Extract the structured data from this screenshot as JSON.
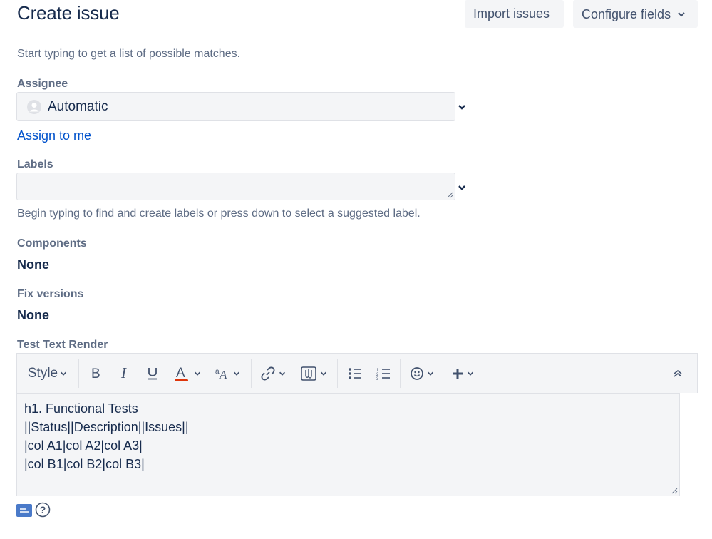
{
  "header": {
    "title": "Create issue",
    "import_label": "Import issues",
    "configure_label": "Configure fields"
  },
  "assignee": {
    "help_text": "Start typing to get a list of possible matches.",
    "label": "Assignee",
    "value": "Automatic",
    "assign_to_me": "Assign to me"
  },
  "labels": {
    "label": "Labels",
    "value": "",
    "help_text": "Begin typing to find and create labels or press down to select a suggested label."
  },
  "components": {
    "label": "Components",
    "value": "None"
  },
  "fix_versions": {
    "label": "Fix versions",
    "value": "None"
  },
  "test_text_render": {
    "label": "Test Text Render",
    "style_label": "Style",
    "lines": [
      "h1. Functional Tests",
      "||Status||Description||Issues||",
      "|col A1|col A2|col A3|",
      "|col B1|col B2|col B3|"
    ]
  },
  "toolbar_icons": [
    "bold-icon",
    "italic-icon",
    "underline-icon",
    "text-color-icon",
    "text-effects-icon",
    "link-icon",
    "attachment-icon",
    "bullet-list-icon",
    "numbered-list-icon",
    "emoji-icon",
    "plus-icon",
    "collapse-icon"
  ],
  "colors": {
    "link": "#0052cc",
    "text": "#172b4d",
    "subtle": "#5e6c84",
    "field_bg": "#f4f5f7",
    "text_color_underline": "#de350b"
  }
}
